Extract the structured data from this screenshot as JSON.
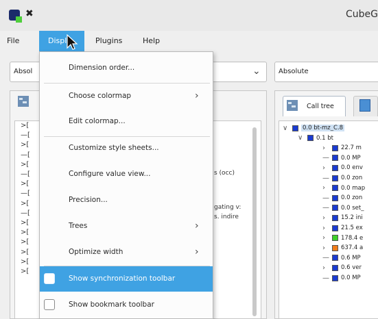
{
  "window": {
    "title": "CubeG"
  },
  "menubar": {
    "file": "File",
    "display": "Displa",
    "plugins": "Plugins",
    "help": "Help"
  },
  "display_menu": {
    "items": [
      {
        "label": "Dimension order..."
      },
      {
        "label": "Choose colormap",
        "submenu": true
      },
      {
        "label": "Edit colormap..."
      },
      {
        "label": "Customize style sheets..."
      },
      {
        "label": "Configure value view..."
      },
      {
        "label": "Precision..."
      },
      {
        "label": "Trees",
        "submenu": true
      },
      {
        "label": "Optimize width",
        "submenu": true
      },
      {
        "label": "Show synchronization toolbar",
        "checkbox": true,
        "highlighted": true
      },
      {
        "label": "Show bookmark toolbar",
        "checkbox": true
      }
    ]
  },
  "left_panel": {
    "combo_value": "Absol",
    "text_snippets": [
      "s (occ)",
      "gating v:",
      "s. indire"
    ]
  },
  "right_panel": {
    "combo_value": "Absolute",
    "tab_label": "Call tree",
    "tree": [
      {
        "text": "0.0 bt-mz_C.8",
        "color": "#1a3bd1",
        "indent": 0,
        "expander": "open",
        "selected": true
      },
      {
        "text": "0.1 bt",
        "color": "#1a3bd1",
        "indent": 1,
        "expander": "open"
      },
      {
        "text": "22.7 m",
        "color": "#1a3bd1",
        "indent": 2,
        "expander": "closed"
      },
      {
        "text": "0.0 MP",
        "color": "#1a3bd1",
        "indent": 2,
        "expander": "leaf"
      },
      {
        "text": "0.0 env",
        "color": "#1a3bd1",
        "indent": 2,
        "expander": "closed"
      },
      {
        "text": "0.0 zon",
        "color": "#1a3bd1",
        "indent": 2,
        "expander": "leaf"
      },
      {
        "text": "0.0 map",
        "color": "#1a3bd1",
        "indent": 2,
        "expander": "closed"
      },
      {
        "text": "0.0 zon",
        "color": "#1a3bd1",
        "indent": 2,
        "expander": "leaf"
      },
      {
        "text": "0.0 set_",
        "color": "#1a3bd1",
        "indent": 2,
        "expander": "leaf"
      },
      {
        "text": "15.2 ini",
        "color": "#1a3bd1",
        "indent": 2,
        "expander": "closed"
      },
      {
        "text": "21.5 ex",
        "color": "#1a3bd1",
        "indent": 2,
        "expander": "closed"
      },
      {
        "text": "178.4 e",
        "color": "#3fcf2a",
        "indent": 2,
        "expander": "closed"
      },
      {
        "text": "637.4 a",
        "color": "#f07d1a",
        "indent": 2,
        "expander": "closed"
      },
      {
        "text": "0.6 MP",
        "color": "#1a3bd1",
        "indent": 2,
        "expander": "leaf"
      },
      {
        "text": "0.6 ver",
        "color": "#1a3bd1",
        "indent": 2,
        "expander": "closed"
      },
      {
        "text": "0.0 MP",
        "color": "#1a3bd1",
        "indent": 2,
        "expander": "leaf"
      }
    ]
  },
  "colors": {
    "accent": "#3fa2e3",
    "tree_blue": "#1a3bd1",
    "tree_green": "#3fcf2a",
    "tree_orange": "#f07d1a"
  }
}
